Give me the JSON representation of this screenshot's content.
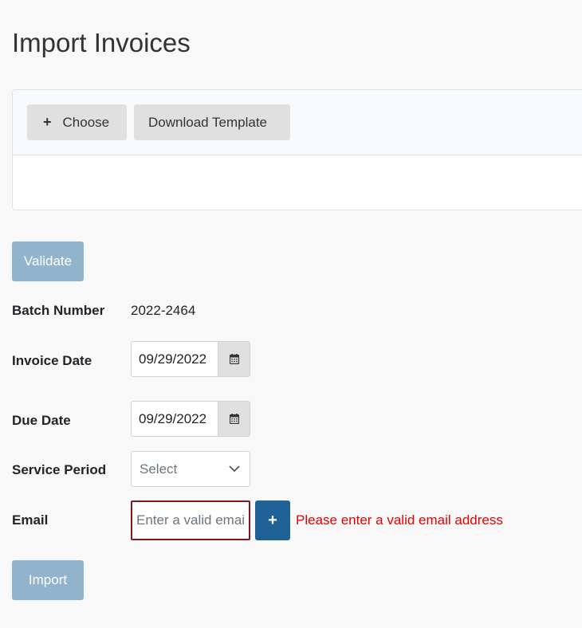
{
  "page": {
    "title": "Import Invoices"
  },
  "upload": {
    "choose_label": "Choose",
    "choose_icon": "plus-icon",
    "template_label": "Download Template"
  },
  "validate_label": "Validate",
  "form": {
    "batch_number": {
      "label": "Batch Number",
      "value": "2022-2464"
    },
    "invoice_date": {
      "label": "Invoice Date",
      "value": "09/29/2022",
      "icon": "calendar-icon"
    },
    "due_date": {
      "label": "Due Date",
      "value": "09/29/2022",
      "icon": "calendar-icon"
    },
    "service_period": {
      "label": "Service Period",
      "selected": "Select",
      "icon": "chevron-down-icon"
    },
    "email": {
      "label": "Email",
      "value": "",
      "placeholder": "Enter a valid email",
      "add_icon": "plus-icon",
      "error": "Please enter a valid email address"
    }
  },
  "import_label": "Import",
  "colors": {
    "primary": "#1f6396",
    "primary_disabled": "#91b3cc",
    "error": "#e60000",
    "invalid_border": "#7b1c1c"
  }
}
